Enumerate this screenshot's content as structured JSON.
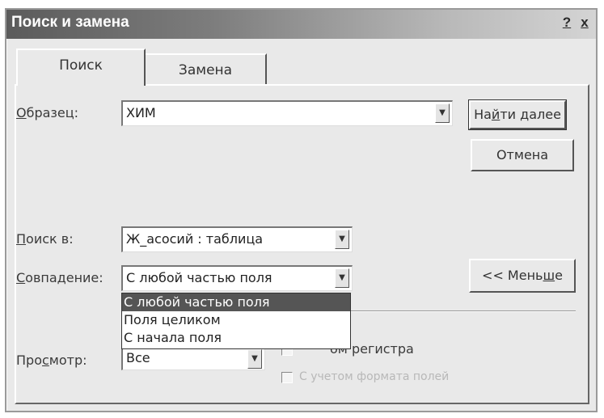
{
  "dialog": {
    "title": "Поиск и замена",
    "help_btn": "?",
    "close_btn": "x"
  },
  "tabs": [
    {
      "label": "Поиск",
      "active": true
    },
    {
      "label": "Замена",
      "active": false
    }
  ],
  "search": {
    "label_prefix": "О",
    "label_rest": "бразец:",
    "value": "ХИМ"
  },
  "look_in": {
    "label_prefix": "П",
    "label_rest": "оиск в:",
    "value": "Ж_асосий : таблица"
  },
  "match": {
    "label_prefix": "С",
    "label_rest": "овпадение:",
    "value": "С любой частью поля",
    "options": [
      "С любой частью поля",
      "Поля целиком",
      "С начала поля"
    ]
  },
  "direction": {
    "label_a": "Про",
    "label_u": "с",
    "label_b": "мотр:",
    "value": "Все"
  },
  "buttons": {
    "find_next_a": "На",
    "find_next_u": "й",
    "find_next_b": "ти далее",
    "cancel": "Отмена",
    "less_a": "<< Мень",
    "less_u": "ш",
    "less_b": "е"
  },
  "checks": {
    "match_case": "ом регистра",
    "match_format": "С учетом формата полей"
  },
  "colors": {
    "title_gradient_start": "#5b5b5b",
    "selection": "#555555"
  }
}
